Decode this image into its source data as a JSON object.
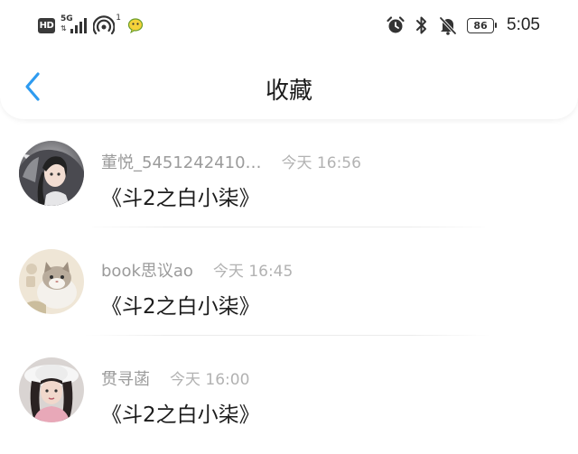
{
  "status_bar": {
    "hd_label": "HD",
    "network_gen": "5G",
    "hotspot_count": "1",
    "battery_level": "86",
    "time": "5:05",
    "icons": [
      "hd-icon",
      "signal-icon",
      "hotspot-icon",
      "wechat-icon",
      "alarm-icon",
      "bluetooth-icon",
      "mute-bell-icon",
      "battery-icon"
    ]
  },
  "header": {
    "title": "收藏",
    "back_icon": "chevron-left-icon",
    "accent_color": "#2e9bf0"
  },
  "favorites": [
    {
      "username": "董悦_5451242410…",
      "time": "今天 16:56",
      "content": "《斗2之白小柒》",
      "avatar": "anime-girl-avatar"
    },
    {
      "username": "book思议ao",
      "time": "今天 16:45",
      "content": "《斗2之白小柒》",
      "avatar": "cat-avatar"
    },
    {
      "username": "贯寻菡",
      "time": "今天 16:00",
      "content": "《斗2之白小柒》",
      "avatar": "girl-hat-avatar"
    }
  ]
}
